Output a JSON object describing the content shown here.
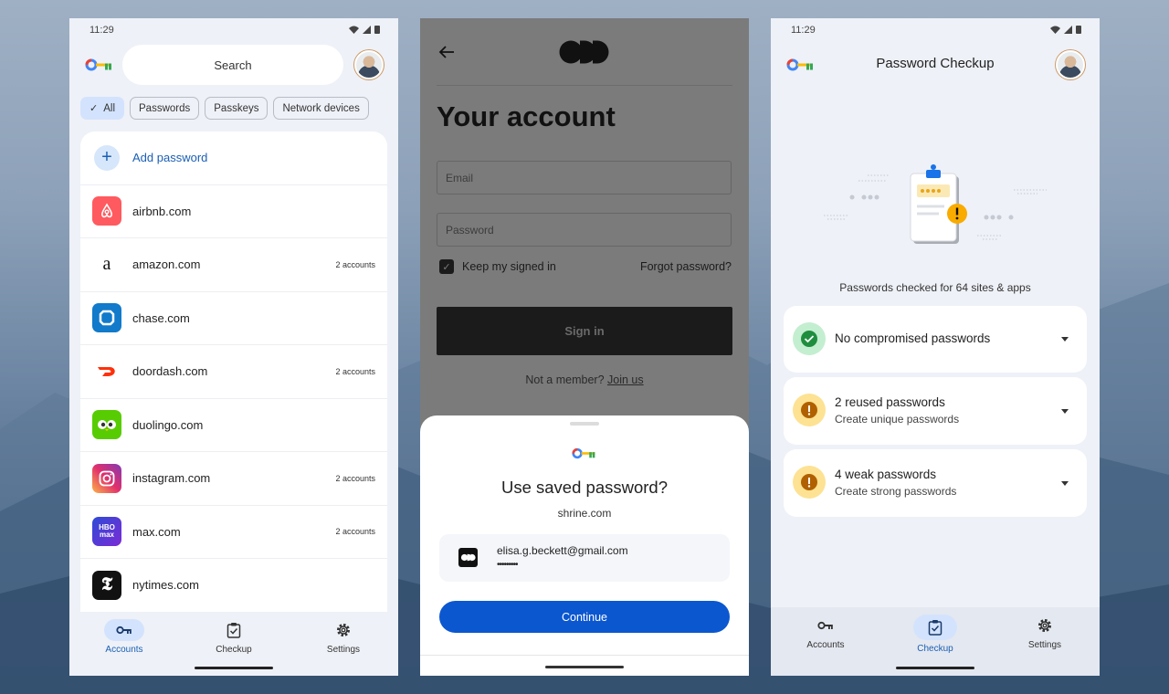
{
  "status": {
    "time": "11:29"
  },
  "passwords_screen": {
    "search_placeholder": "Search",
    "chips": [
      {
        "label": "All",
        "selected": true
      },
      {
        "label": "Passwords",
        "selected": false
      },
      {
        "label": "Passkeys",
        "selected": false
      },
      {
        "label": "Network devices",
        "selected": false
      }
    ],
    "add_label": "Add password",
    "items": [
      {
        "name": "airbnb.com",
        "accounts": "",
        "icon": "airbnb-icon",
        "color": "#ff5a5f"
      },
      {
        "name": "amazon.com",
        "accounts": "2 accounts",
        "icon": "amazon-icon",
        "color": "#ffffff"
      },
      {
        "name": "chase.com",
        "accounts": "",
        "icon": "chase-icon",
        "color": "#117aca"
      },
      {
        "name": "doordash.com",
        "accounts": "2 accounts",
        "icon": "doordash-icon",
        "color": "#ffffff"
      },
      {
        "name": "duolingo.com",
        "accounts": "",
        "icon": "duolingo-icon",
        "color": "#58cc02"
      },
      {
        "name": "instagram.com",
        "accounts": "2 accounts",
        "icon": "instagram-icon",
        "color": "#e1306c"
      },
      {
        "name": "max.com",
        "accounts": "2 accounts",
        "icon": "max-icon",
        "color": "#5a2bd6"
      },
      {
        "name": "nytimes.com",
        "accounts": "",
        "icon": "nytimes-icon",
        "color": "#111111"
      }
    ],
    "nav": [
      {
        "label": "Accounts",
        "icon": "key-icon",
        "active": true
      },
      {
        "label": "Checkup",
        "icon": "clipboard-check-icon",
        "active": false
      },
      {
        "label": "Settings",
        "icon": "gear-icon",
        "active": false
      }
    ]
  },
  "signin_screen": {
    "title": "Your account",
    "email_placeholder": "Email",
    "password_placeholder": "Password",
    "keep_signed_in": "Keep my signed in",
    "keep_checked": true,
    "forgot": "Forgot password?",
    "signin_button": "Sign in",
    "not_member": "Not a member?",
    "join": "Join us",
    "sheet": {
      "title": "Use saved password?",
      "site": "shrine.com",
      "email": "elisa.g.beckett@gmail.com",
      "password_mask": "•••••••••",
      "continue": "Continue"
    }
  },
  "checkup_screen": {
    "title": "Password Checkup",
    "checked_text": "Passwords checked for 64 sites & apps",
    "cards": [
      {
        "title": "No compromised passwords",
        "subtitle": "",
        "status": "ok",
        "color": "#1e8e3e"
      },
      {
        "title": "2 reused passwords",
        "subtitle": "Create unique passwords",
        "status": "warning",
        "color": "#b06000"
      },
      {
        "title": "4 weak passwords",
        "subtitle": "Create strong passwords",
        "status": "warning",
        "color": "#b06000"
      }
    ],
    "nav": [
      {
        "label": "Accounts",
        "icon": "key-icon",
        "active": false
      },
      {
        "label": "Checkup",
        "icon": "clipboard-check-icon",
        "active": true
      },
      {
        "label": "Settings",
        "icon": "gear-icon",
        "active": false
      }
    ]
  }
}
